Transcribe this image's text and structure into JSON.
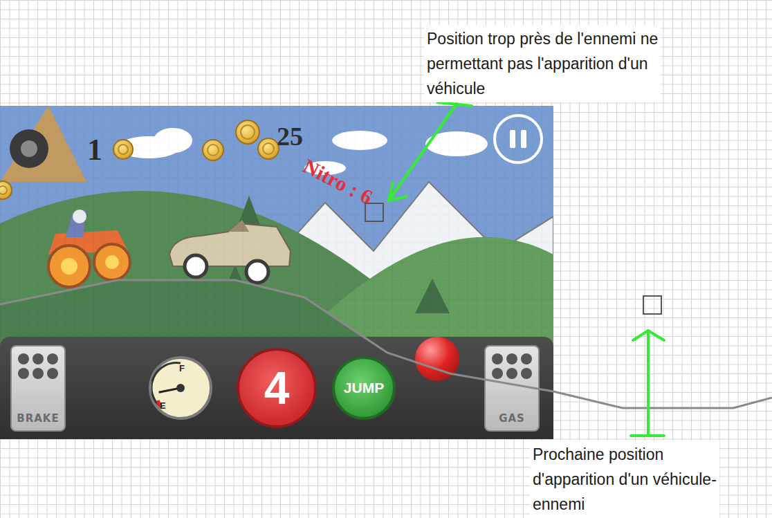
{
  "annotations": {
    "too_close": {
      "lines": [
        "Position trop près de l'ennemi ne",
        "permettant pas l'apparition d'un",
        "véhicule"
      ]
    },
    "next_spawn": {
      "lines": [
        "Prochaine position",
        "d'apparition d'un véhicule-",
        "ennemi"
      ]
    }
  },
  "hud": {
    "lives": "1",
    "coins": "25",
    "nitro": "Nitro : 6"
  },
  "dashboard": {
    "brake": "BRAKE",
    "fuel": {
      "full": "F",
      "empty": "E",
      "level": 0.25
    },
    "nitro_charges": "4",
    "jump": "JUMP",
    "gas": "GAS"
  }
}
